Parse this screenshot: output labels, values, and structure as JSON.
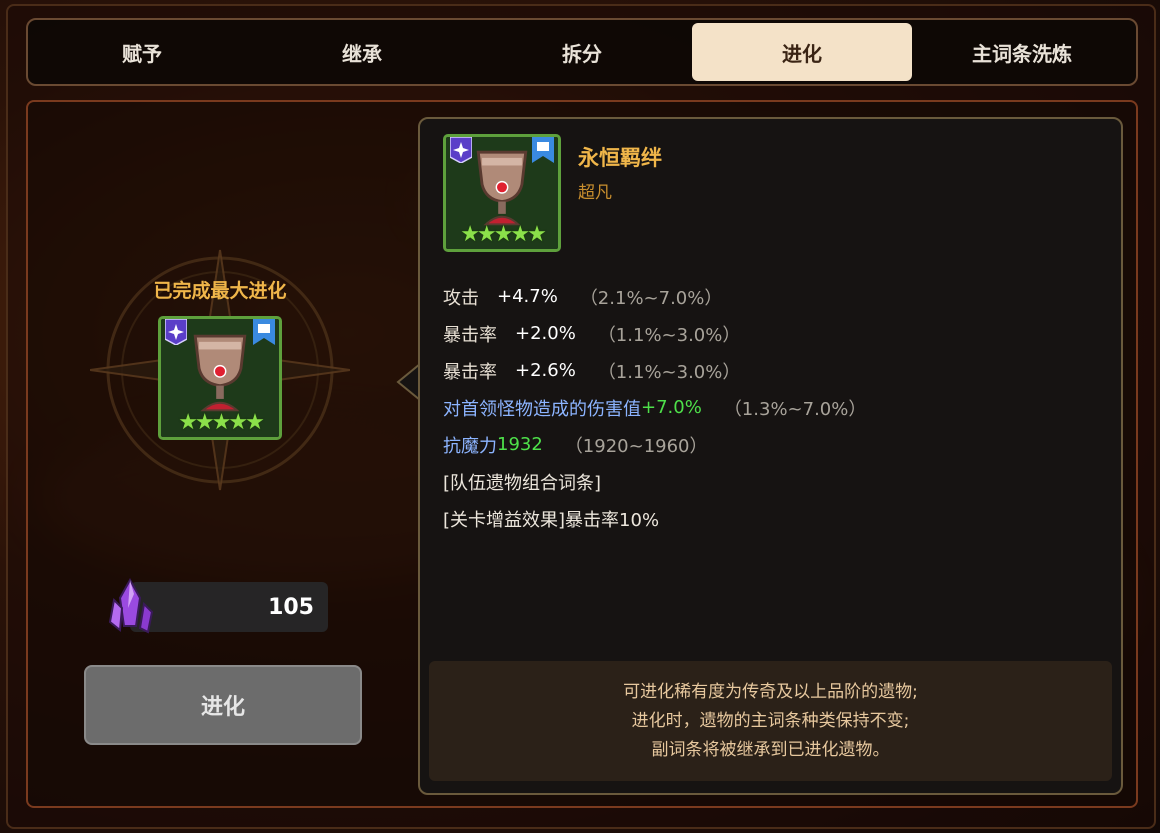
{
  "tabs": [
    {
      "label": "赋予",
      "active": false
    },
    {
      "label": "继承",
      "active": false
    },
    {
      "label": "拆分",
      "active": false
    },
    {
      "label": "进化",
      "active": true
    },
    {
      "label": "主词条洗炼",
      "active": false
    }
  ],
  "left_panel": {
    "status_label": "已完成最大进化",
    "item_icon": "chalice-icon",
    "item_stars": "★★★★★",
    "currency_icon": "purple-crystal-icon",
    "currency_amount": "105",
    "evolve_button_label": "进化"
  },
  "item": {
    "name": "永恒羁绊",
    "rarity": "超凡",
    "stars": "★★★★★",
    "badges": [
      "rarity-badge-icon",
      "bookmark-icon"
    ]
  },
  "stats": [
    {
      "name": "攻击",
      "value": "+4.7%",
      "range": "（2.1%~7.0%）"
    },
    {
      "name": "暴击率",
      "value": "+2.0%",
      "range": "（1.1%~3.0%）"
    },
    {
      "name": "暴击率",
      "value": "+2.6%",
      "range": "（1.1%~3.0%）"
    },
    {
      "name": "对首领怪物造成的伤害值",
      "value": "+7.0%",
      "range": "（1.3%~7.0%）"
    },
    {
      "name": "抗魔力",
      "value": "1932",
      "range": "（1920~1960）"
    }
  ],
  "set_title": "[队伍遗物组合词条]",
  "set_bonus": "[关卡增益效果]暴击率10%",
  "note_lines": [
    "可进化稀有度为传奇及以上品阶的遗物;",
    "进化时，遗物的主词条种类保持不变;",
    "副词条将被继承到已进化遗物。"
  ],
  "colors": {
    "gold": "#f0b64a",
    "green": "#4ee04a",
    "blue_stat": "#8cb4ff",
    "tab_active_bg": "#f4e2c8"
  }
}
